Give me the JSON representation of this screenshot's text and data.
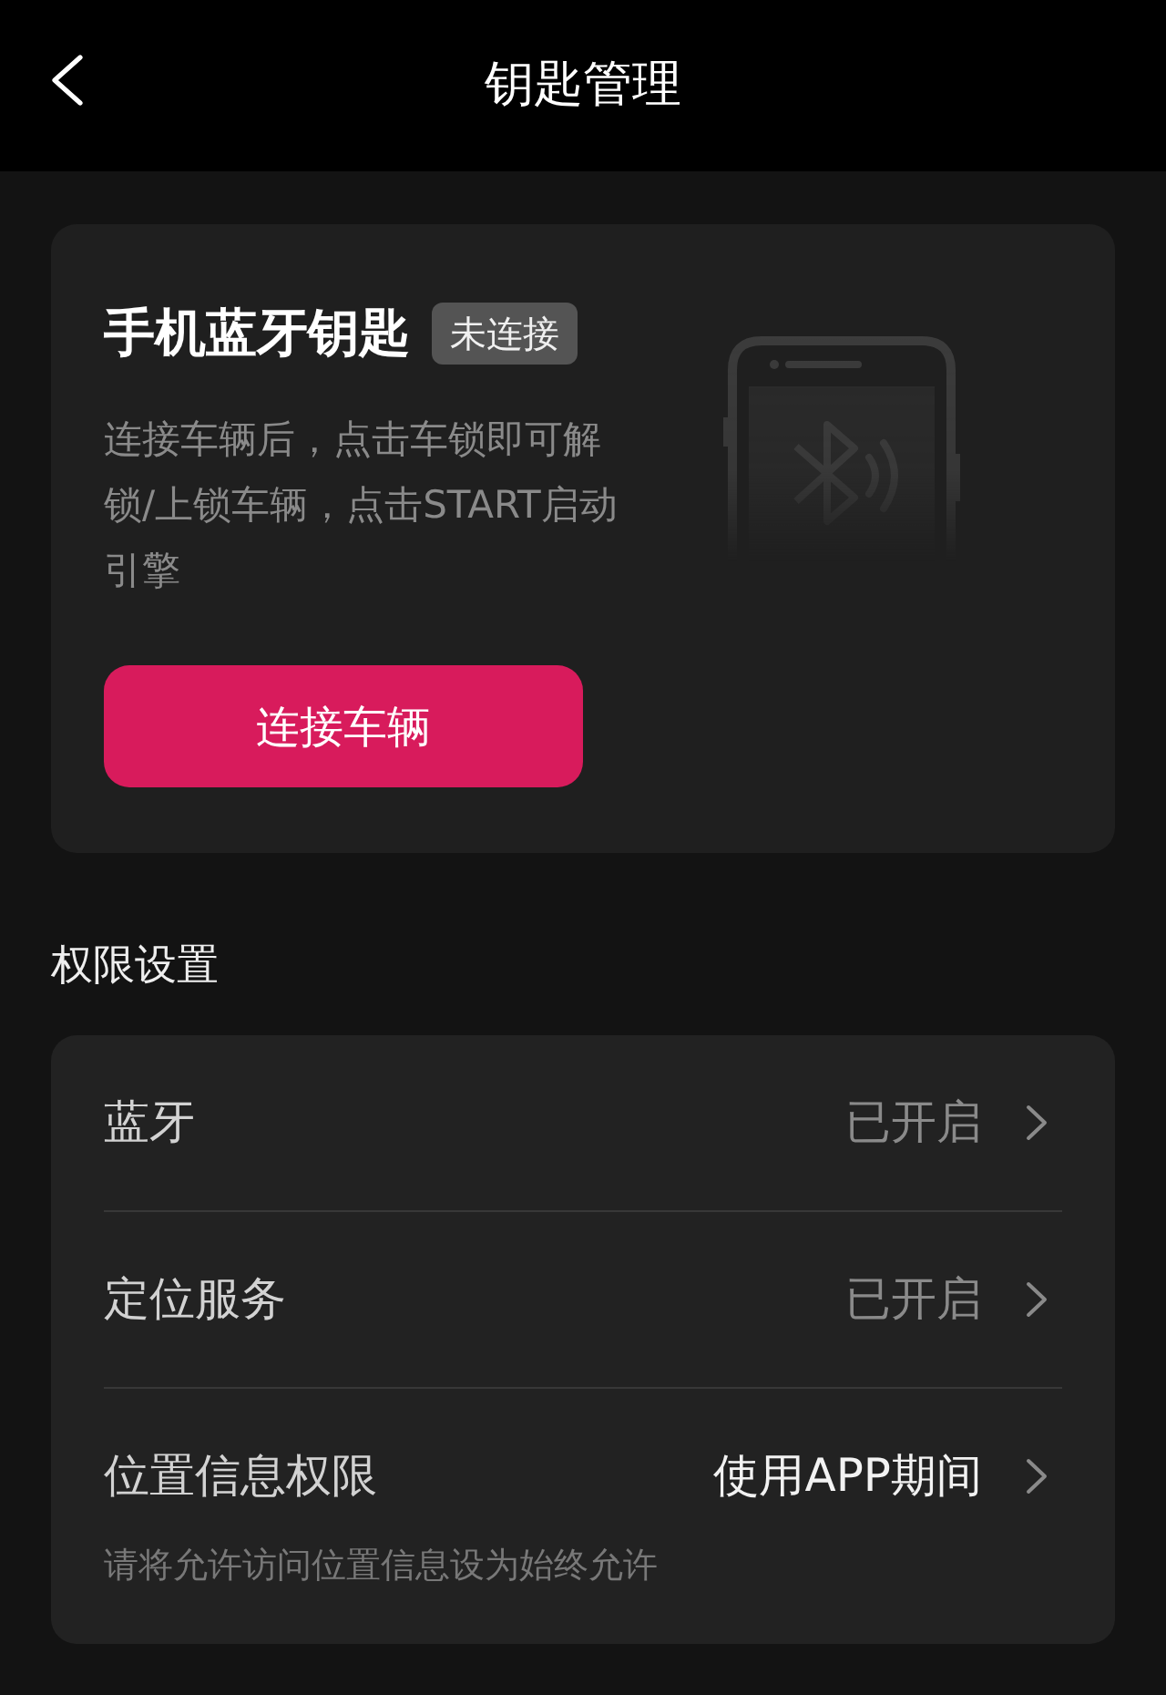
{
  "header": {
    "title": "钥匙管理"
  },
  "key_card": {
    "title": "手机蓝牙钥匙",
    "status": "未连接",
    "description": "连接车辆后，点击车锁即可解锁/上锁车辆，点击START启动引擎",
    "button": "连接车辆"
  },
  "permissions": {
    "title": "权限设置",
    "items": [
      {
        "label": "蓝牙",
        "value": "已开启",
        "emphasized": false
      },
      {
        "label": "定位服务",
        "value": "已开启",
        "emphasized": false
      },
      {
        "label": "位置信息权限",
        "value": "使用APP期间",
        "emphasized": true,
        "hint": "请将允许访问位置信息设为始终允许"
      }
    ]
  }
}
